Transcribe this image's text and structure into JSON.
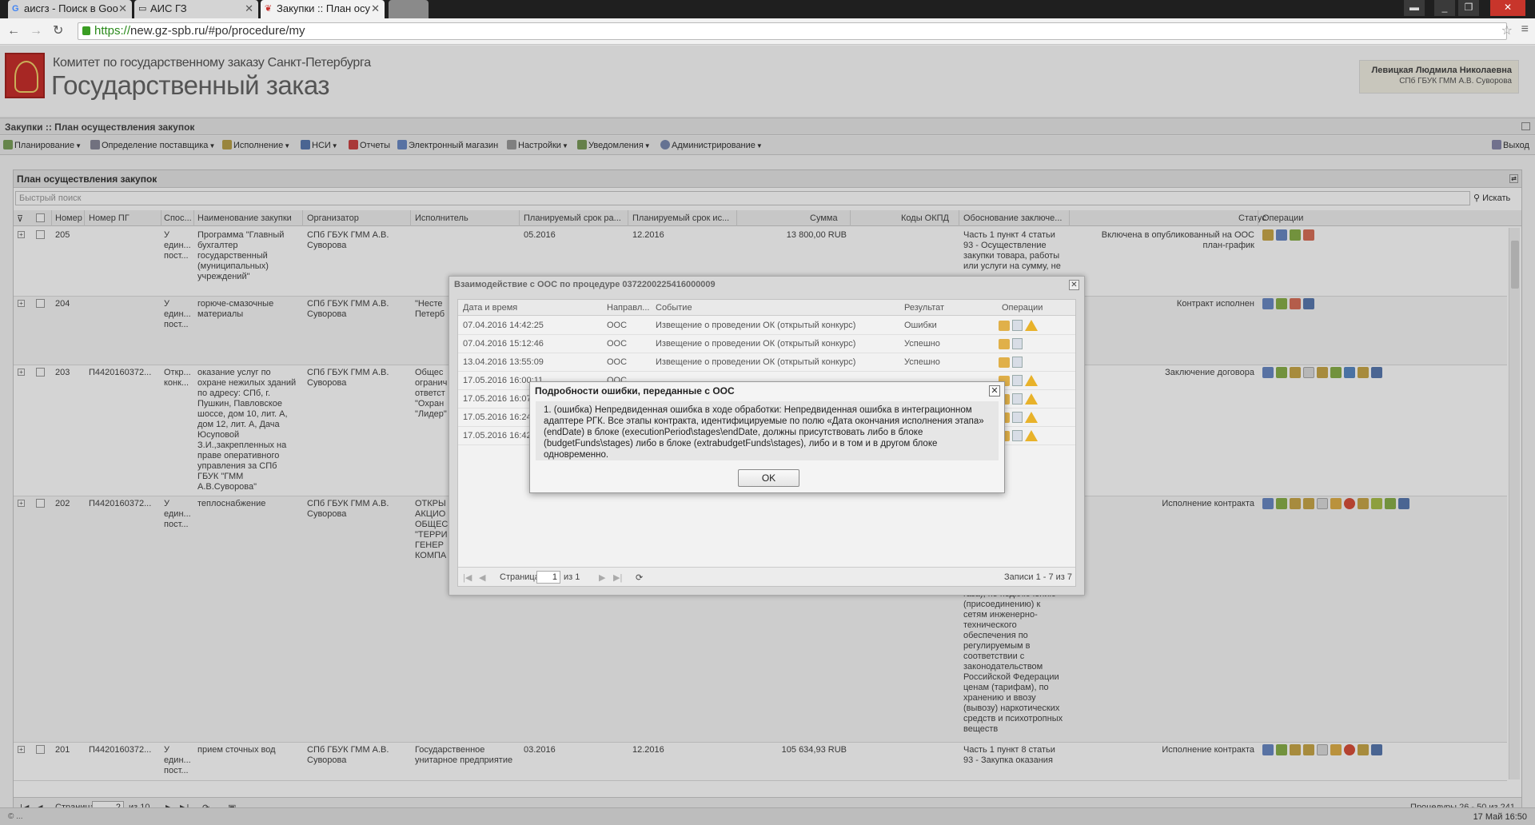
{
  "browser": {
    "tabs": [
      {
        "title": "аисгз - Поиск в Goo",
        "icon": "G"
      },
      {
        "title": "АИС ГЗ",
        "icon": ""
      },
      {
        "title": "Закупки :: План осу",
        "icon": ""
      }
    ],
    "url_scheme": "https://",
    "url_rest": "new.gz-spb.ru/#po/procedure/my"
  },
  "header": {
    "org_name": "Комитет по государственному заказу Санкт-Петербурга",
    "app_name": "Государственный заказ",
    "user_name": "Левицкая Людмила Николаевна",
    "user_org": "СПб ГБУК ГММ А.В. Суворова"
  },
  "breadcrumb": "Закупки :: План осуществления закупок",
  "toolbar": {
    "items": [
      "Планирование",
      "Определение поставщика",
      "Исполнение",
      "НСИ",
      "Отчеты",
      "Электронный магазин",
      "Настройки",
      "Уведомления",
      "Администрирование"
    ],
    "exit": "Выход"
  },
  "panel": {
    "title": "План осуществления закупок",
    "search_placeholder": "Быстрый поиск",
    "search_button": "Искать",
    "columns": [
      "Номер",
      "Номер ПГ",
      "Спос...",
      "Наименование закупки",
      "Организатор",
      "Исполнитель",
      "Планируемый срок ра...",
      "Планируемый срок ис...",
      "Сумма",
      "Коды ОКПД",
      "Обоснование заключе...",
      "Статус",
      "Операции"
    ],
    "rows": [
      {
        "num": "205",
        "pg": "",
        "method": "У един... пост...",
        "name": "Программа \"Главный бухгалтер государственный (муниципальных) учреждений\"",
        "org": "СПб ГБУК ГММ А.В. Суворова",
        "exec": "",
        "start": "05.2016",
        "end": "12.2016",
        "sum": "13 800,00 RUB",
        "basis": "Часть 1 пункт 4 статьи 93 - Осуществление закупки товара, работы или услуги на сумму, не",
        "status": "Включена в опубликованный на ООС план-график"
      },
      {
        "num": "204",
        "pg": "",
        "method": "У един... пост...",
        "name": "горюче-смазочные материалы",
        "org": "СПб ГБУК ГММ А.В. Суворова",
        "exec": "\"Несте Петерб",
        "start": "",
        "end": "",
        "sum": "",
        "basis": "",
        "status": "Контракт исполнен"
      },
      {
        "num": "203",
        "pg": "П4420160372...",
        "method": "Откр... конк...",
        "name": "оказание услуг по охране нежилых зданий по адресу: СПб, г. Пушкин, Павловское шоссе, дом 10, лит. А, дом 12, лит. А, Дача Юсуповой З.И.,закрепленных на праве оперативного управления за СПб ГБУК \"ГММ А.В.Суворова\"",
        "org": "СПб ГБУК ГММ А.В. Суворова",
        "exec": "Общес огранич ответст \"Охран \"Лидер\"",
        "start": "",
        "end": "",
        "sum": "",
        "basis": "",
        "status": "Заключение договора"
      },
      {
        "num": "202",
        "pg": "П4420160372...",
        "method": "У един... пост...",
        "name": "теплоснабжение",
        "org": "СПб ГБУК ГММ А.В. Суворова",
        "exec": "ОТКРЫ АКЦИО ОБЩЕС \"ТЕРРИ ГЕНЕР КОМПА",
        "start": "",
        "end": "",
        "sum": "",
        "basis": "газа), по подключению (присоединению) к сетям инженерно-технического обеспечения по регулируемым в соответствии с законодательством Российской Федерации ценам (тарифам), по хранению и ввозу (вывозу) наркотических средств и психотропных веществ",
        "status": "Исполнение контракта"
      },
      {
        "num": "201",
        "pg": "П4420160372...",
        "method": "У един... пост...",
        "name": "прием сточных вод",
        "org": "СПб ГБУК ГММ А.В. Суворова",
        "exec": "Государственное унитарное предприятие",
        "start": "03.2016",
        "end": "12.2016",
        "sum": "105 634,93 RUB",
        "basis": "Часть 1 пункт 8 статьи 93 - Закупка оказания",
        "status": "Исполнение контракта"
      }
    ],
    "pager": {
      "page_label": "Страница",
      "page": "2",
      "of": "из 10",
      "summary": "Процедуры 26 - 50 из 241"
    }
  },
  "interaction_window": {
    "title": "Взаимодействие с ООС по процедуре 0372200225416000009",
    "columns": [
      "Дата и время",
      "Направл...",
      "Событие",
      "Результат",
      "Операции"
    ],
    "rows": [
      {
        "date": "07.04.2016 14:42:25",
        "dir": "ООС",
        "event": "Извещение о проведении ОК (открытый конкурс)",
        "result": "Ошибки",
        "warn": true
      },
      {
        "date": "07.04.2016 15:12:46",
        "dir": "ООС",
        "event": "Извещение о проведении ОК (открытый конкурс)",
        "result": "Успешно",
        "warn": false
      },
      {
        "date": "13.04.2016 13:55:09",
        "dir": "ООС",
        "event": "Извещение о проведении ОК (открытый конкурс)",
        "result": "Успешно",
        "warn": false
      },
      {
        "date": "17.05.2016 16:00:11",
        "dir": "ООС",
        "event": "",
        "result": "",
        "warn": true
      },
      {
        "date": "17.05.2016 16:07",
        "dir": "",
        "event": "",
        "result": "",
        "warn": true
      },
      {
        "date": "17.05.2016 16:24",
        "dir": "",
        "event": "",
        "result": "",
        "warn": true
      },
      {
        "date": "17.05.2016 16:42",
        "dir": "",
        "event": "",
        "result": "",
        "warn": true
      }
    ],
    "pager": {
      "page_label": "Страница",
      "page": "1",
      "of": "из 1",
      "summary": "Записи 1 - 7 из 7"
    }
  },
  "error_dialog": {
    "title": "Подробности ошибки, переданные с ООС",
    "message": "1. (ошибка) Непредвиденная ошибка в ходе обработки: Непредвиденная ошибка в интеграционном адаптере РГК. Все этапы контракта, идентифицируемые по полю «Дата окончания исполнения этапа» (endDate) в блоке (executionPeriod\\stages\\endDate, должны присутствовать либо в блоке (budgetFunds\\stages) либо в блоке (extrabudgetFunds\\stages), либо и в том и в другом блоке одновременно.",
    "ok": "OK"
  },
  "statusbar": {
    "left": "© ...",
    "right": "17 Май 16:50"
  }
}
